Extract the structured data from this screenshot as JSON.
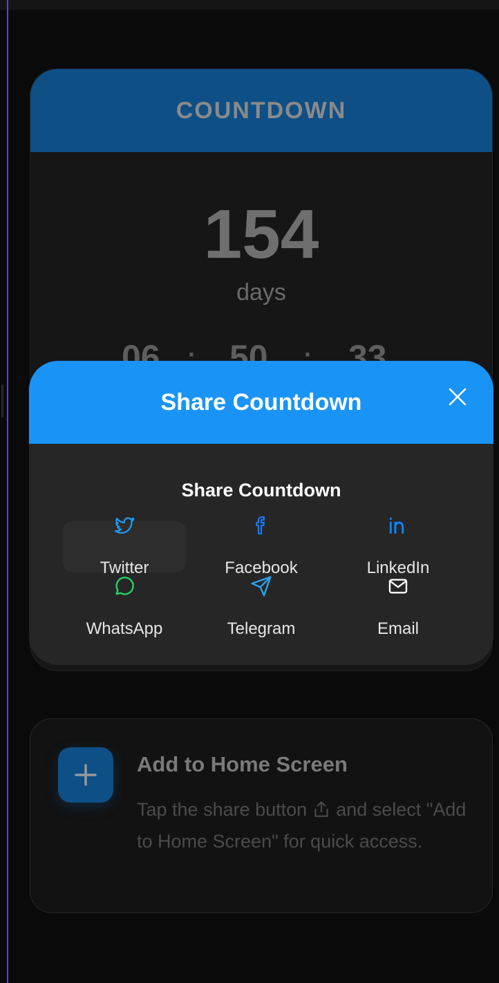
{
  "countdown": {
    "title": "COUNTDOWN",
    "days_value": "154",
    "days_label": "days",
    "hours": "06",
    "minutes": "50",
    "seconds": "33",
    "separator": "·"
  },
  "share_modal": {
    "header_title": "Share Countdown",
    "subtitle": "Share Countdown",
    "options": [
      {
        "label": "Twitter",
        "icon": "twitter-icon",
        "color": "#1d9bf0"
      },
      {
        "label": "Facebook",
        "icon": "facebook-icon",
        "color": "#1877f2"
      },
      {
        "label": "LinkedIn",
        "icon": "linkedin-icon",
        "color": "#0a84ff"
      },
      {
        "label": "WhatsApp",
        "icon": "whatsapp-icon",
        "color": "#25d366"
      },
      {
        "label": "Telegram",
        "icon": "telegram-icon",
        "color": "#2aa3ef"
      },
      {
        "label": "Email",
        "icon": "mail-icon",
        "color": "#ffffff"
      }
    ]
  },
  "home_screen": {
    "title": "Add to Home Screen",
    "desc_before": "Tap the share button",
    "desc_after": "and select \"Add to Home Screen\" for quick access."
  },
  "colors": {
    "accent": "#1994f6",
    "card_header": "#0e4f86",
    "modal_body": "#262626"
  }
}
